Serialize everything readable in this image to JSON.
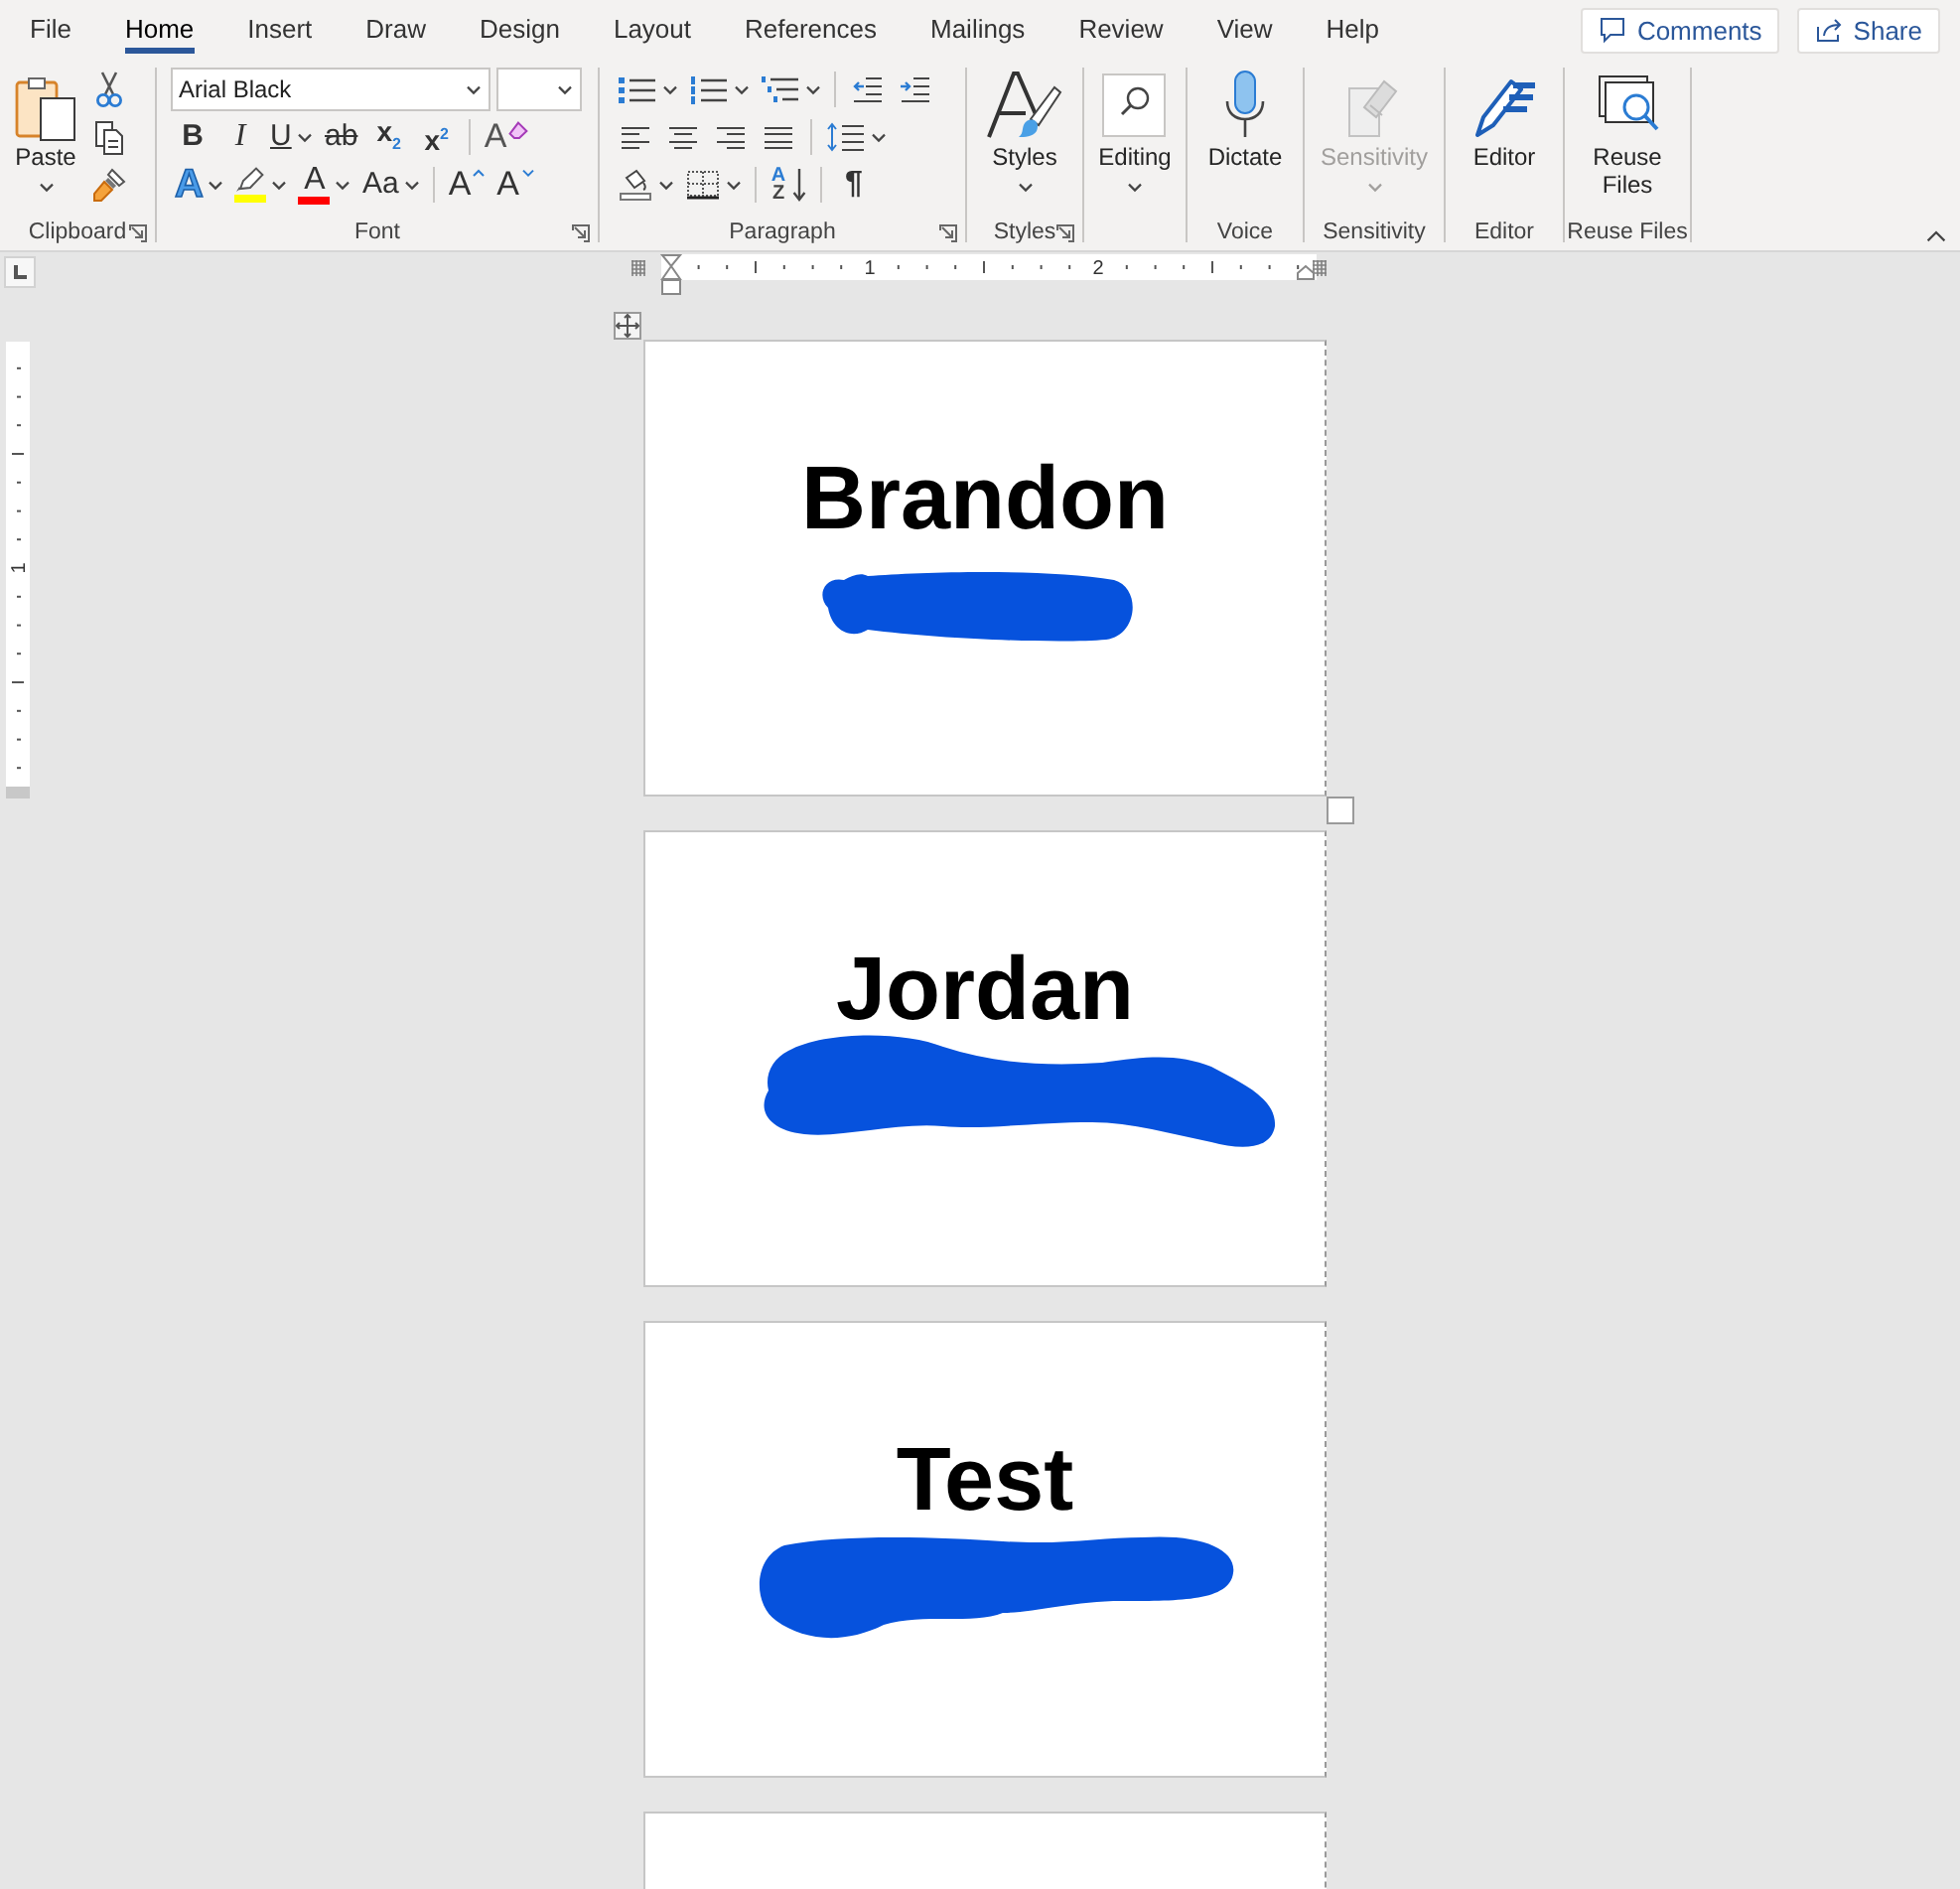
{
  "tabs": [
    {
      "label": "File",
      "selected": false
    },
    {
      "label": "Home",
      "selected": true
    },
    {
      "label": "Insert",
      "selected": false
    },
    {
      "label": "Draw",
      "selected": false
    },
    {
      "label": "Design",
      "selected": false
    },
    {
      "label": "Layout",
      "selected": false
    },
    {
      "label": "References",
      "selected": false
    },
    {
      "label": "Mailings",
      "selected": false
    },
    {
      "label": "Review",
      "selected": false
    },
    {
      "label": "View",
      "selected": false
    },
    {
      "label": "Help",
      "selected": false
    }
  ],
  "header_buttons": [
    {
      "kind": "comments",
      "label": "Comments"
    },
    {
      "kind": "share",
      "label": "Share"
    }
  ],
  "ribbon_groups": [
    {
      "kind": "clipboard",
      "label": "Clipboard",
      "launcher": true,
      "paste": {
        "label": "Paste",
        "dropdown": true
      },
      "tools": [
        {
          "kind": "cut"
        },
        {
          "kind": "copy"
        },
        {
          "kind": "format_painter"
        }
      ]
    },
    {
      "kind": "font",
      "label": "Font",
      "launcher": true,
      "font_name": "Arial Black",
      "row_1": [
        {
          "kind": "bold",
          "glyph": "B",
          "dropdown": false
        },
        {
          "kind": "italic",
          "glyph": "I",
          "dropdown": false
        },
        {
          "kind": "underline",
          "glyph": "U",
          "dropdown": true
        },
        {
          "kind": "strikethrough",
          "glyph": "ab",
          "dropdown": false
        },
        {
          "kind": "subscript",
          "glyph": "x$_{2}$",
          "dropdown": false
        },
        {
          "kind": "superscript",
          "glyph": "x$^{2}$",
          "dropdown": false
        },
        {
          "kind": "clear_formatting",
          "glyph": "A",
          "dropdown": false
        }
      ],
      "row_2": [
        {
          "kind": "text_effects",
          "glyph": "A",
          "dropdown": true
        },
        {
          "kind": "highlight",
          "color": "#ffff00",
          "dropdown": true
        },
        {
          "kind": "font_color",
          "glyph": "A",
          "color": "#ff0000",
          "dropdown": true
        },
        {
          "kind": "change_case",
          "glyph": "Aa",
          "dropdown": true
        },
        {
          "kind": "grow_font",
          "glyph": "A",
          "dropdown": false
        },
        {
          "kind": "shrink_font",
          "glyph": "A",
          "dropdown": false
        }
      ]
    },
    {
      "kind": "paragraph",
      "label": "Paragraph",
      "launcher": true,
      "row_1": [
        {
          "kind": "bullets",
          "dropdown": true
        },
        {
          "kind": "numbering",
          "dropdown": true
        },
        {
          "kind": "multilevel",
          "dropdown": true
        },
        {
          "kind": "decrease_indent",
          "dropdown": false
        },
        {
          "kind": "increase_indent",
          "dropdown": false
        }
      ],
      "row_2": [
        {
          "kind": "align_left",
          "dropdown": false
        },
        {
          "kind": "align_center",
          "dropdown": false
        },
        {
          "kind": "align_right",
          "dropdown": false
        },
        {
          "kind": "justify",
          "dropdown": false
        },
        {
          "kind": "line_spacing",
          "dropdown": true
        }
      ],
      "row_3": [
        {
          "kind": "shading",
          "dropdown": true
        },
        {
          "kind": "borders",
          "dropdown": true
        },
        {
          "kind": "sort",
          "letters": [
            "A",
            "Z"
          ],
          "dropdown": false
        },
        {
          "kind": "show_marks",
          "glyph": "¶",
          "dropdown": false
        }
      ]
    },
    {
      "kind": "styles",
      "label": "Styles",
      "launcher": true,
      "button": {
        "label": "Styles",
        "dropdown": true,
        "disabled": false
      }
    },
    {
      "kind": "editing",
      "launcher": false,
      "button": {
        "label": "Editing",
        "dropdown": true,
        "disabled": false
      }
    },
    {
      "kind": "voice",
      "label": "Voice",
      "launcher": false,
      "button": {
        "label": "Dictate",
        "dropdown": false,
        "disabled": false
      }
    },
    {
      "kind": "sensitivity",
      "label": "Sensitivity",
      "launcher": false,
      "button": {
        "label": "Sensitivity",
        "dropdown": true,
        "disabled": true
      }
    },
    {
      "kind": "editor",
      "label": "Editor",
      "launcher": false,
      "button": {
        "label": "Editor",
        "dropdown": false,
        "disabled": false
      }
    },
    {
      "kind": "reuse",
      "label": "Reuse Files",
      "launcher": false,
      "button": {
        "label": "Reuse Files",
        "dropdown": false,
        "disabled": false
      }
    }
  ],
  "ruler": {
    "numbers": [
      "1",
      "2"
    ]
  },
  "vertical_ruler": {
    "numbers": [
      "1"
    ]
  },
  "pages": [
    {
      "text": "Brandon",
      "redacted": true
    },
    {
      "text": "Jordan",
      "redacted": true
    },
    {
      "text": "Test",
      "redacted": true
    }
  ]
}
